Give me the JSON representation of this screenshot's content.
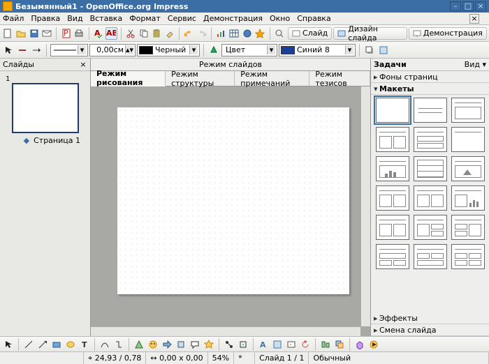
{
  "window": {
    "title": "Безымянный1 - OpenOffice.org Impress"
  },
  "menu": {
    "file": "Файл",
    "edit": "Правка",
    "view": "Вид",
    "insert": "Вставка",
    "format": "Формат",
    "tools": "Сервис",
    "slideshow": "Демонстрация",
    "window": "Окно",
    "help": "Справка"
  },
  "toolbar2": {
    "size_value": "0,00см",
    "color_label": "Черный",
    "fill_label": "Цвет",
    "fill_value": "Синий 8"
  },
  "rightpills": {
    "slide": "Слайд",
    "design": "Дизайн слайда",
    "demo": "Демонстрация"
  },
  "slides_panel": {
    "title": "Слайды",
    "page_label": "Страница 1"
  },
  "mode_bar": {
    "title": "Режим слайдов"
  },
  "tabs": {
    "drawing": "Режим рисования",
    "outline": "Режим структуры",
    "notes": "Режим примечаний",
    "handout": "Режим тезисов"
  },
  "tasks": {
    "title": "Задачи",
    "view_btn": "Вид",
    "sections": {
      "master": "Фоны страниц",
      "layouts": "Макеты",
      "effects": "Эффекты",
      "transition": "Смена слайда"
    }
  },
  "statusbar": {
    "ratio": "24,93 / 0,78",
    "coords": "0,00 x 0,00",
    "zoom": "54%",
    "slide_counter": "Слайд 1 / 1",
    "mode": "Обычный"
  }
}
